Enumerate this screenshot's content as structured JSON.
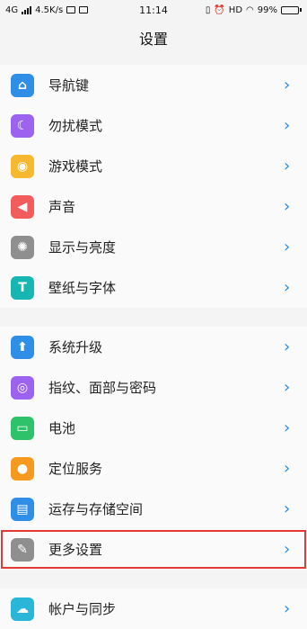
{
  "status_bar": {
    "network": "4G",
    "speed": "4.5K/s",
    "time": "11:14",
    "hd": "HD",
    "battery": "99%",
    "battery_level": 0.99
  },
  "page_title": "设置",
  "groups": [
    {
      "items": [
        {
          "label": "导航键",
          "icon": "navigation-key-icon",
          "color": "#2f8fe6"
        },
        {
          "label": "勿扰模式",
          "icon": "moon-icon",
          "color": "#9b63f0"
        },
        {
          "label": "游戏模式",
          "icon": "gamepad-icon",
          "color": "#f5b82e"
        },
        {
          "label": "声音",
          "icon": "speaker-icon",
          "color": "#f25c5c"
        },
        {
          "label": "显示与亮度",
          "icon": "sun-icon",
          "color": "#8f8f8f"
        },
        {
          "label": "壁纸与字体",
          "icon": "font-t-icon",
          "color": "#16b6b2"
        }
      ]
    },
    {
      "items": [
        {
          "label": "系统升级",
          "icon": "system-update-icon",
          "color": "#2f8fe6"
        },
        {
          "label": "指纹、面部与密码",
          "icon": "fingerprint-icon",
          "color": "#9b63f0"
        },
        {
          "label": "电池",
          "icon": "battery-icon",
          "color": "#2ec36a"
        },
        {
          "label": "定位服务",
          "icon": "location-pin-icon",
          "color": "#f59a1e"
        },
        {
          "label": "运存与存储空间",
          "icon": "storage-icon",
          "color": "#2f8fe6"
        },
        {
          "label": "更多设置",
          "icon": "wrench-icon",
          "color": "#8f8f8f",
          "highlighted": true
        }
      ]
    },
    {
      "items": [
        {
          "label": "帐户与同步",
          "icon": "cloud-sync-icon",
          "color": "#29b6d8"
        }
      ]
    }
  ]
}
